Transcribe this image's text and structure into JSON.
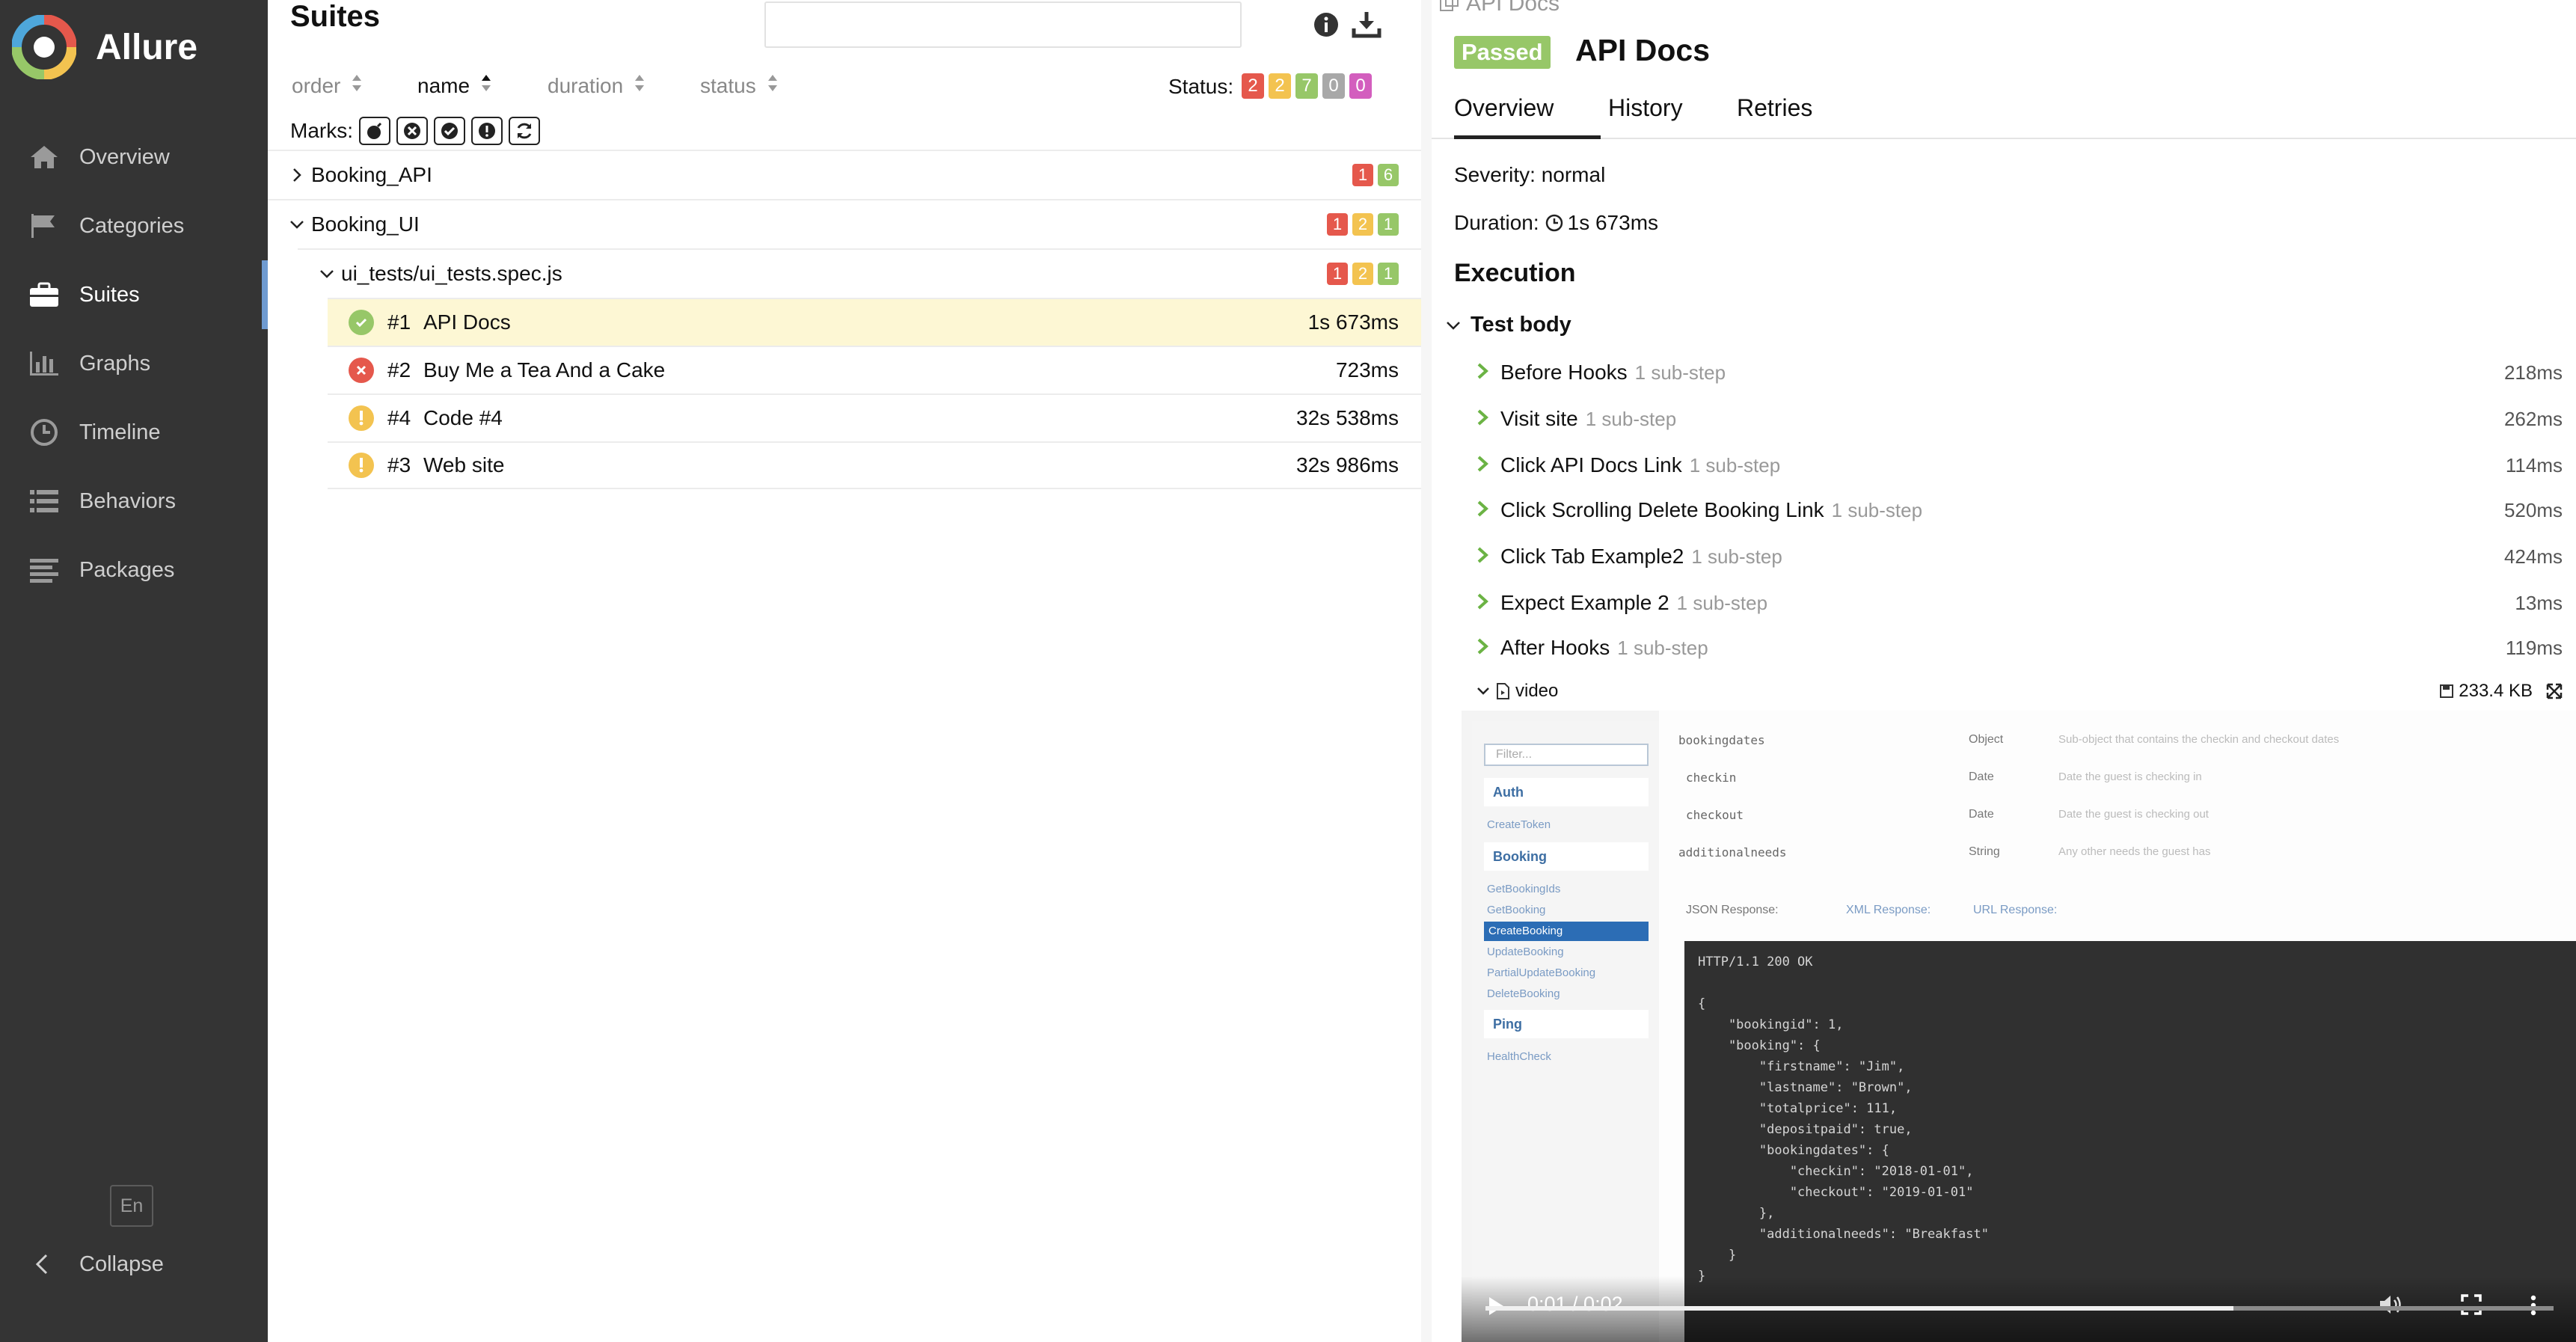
{
  "sidebar": {
    "brand": "Allure",
    "items": [
      {
        "label": "Overview",
        "icon": "home-icon"
      },
      {
        "label": "Categories",
        "icon": "flag-icon"
      },
      {
        "label": "Suites",
        "icon": "briefcase-icon"
      },
      {
        "label": "Graphs",
        "icon": "bar-chart-icon"
      },
      {
        "label": "Timeline",
        "icon": "clock-icon"
      },
      {
        "label": "Behaviors",
        "icon": "list-icon"
      },
      {
        "label": "Packages",
        "icon": "align-left-icon"
      }
    ],
    "active_item": "Suites",
    "language": "En",
    "collapse": "Collapse",
    "accent": "#6f9bd1"
  },
  "suites": {
    "title": "Suites",
    "search": {
      "value": "",
      "placeholder": ""
    },
    "sort": {
      "order": "order",
      "name": "name",
      "duration": "duration",
      "status": "status"
    },
    "status_label": "Status:",
    "status_counts": [
      {
        "value": "2",
        "color": "#e5584c"
      },
      {
        "value": "2",
        "color": "#f3c350"
      },
      {
        "value": "7",
        "color": "#97c768"
      },
      {
        "value": "0",
        "color": "#a8a8a8"
      },
      {
        "value": "0",
        "color": "#d35ebe"
      }
    ],
    "marks_label": "Marks:",
    "groups": [
      {
        "name": "Booking_API",
        "expanded": false,
        "badges": [
          {
            "v": "1",
            "c": "red"
          },
          {
            "v": "6",
            "c": "green"
          }
        ]
      },
      {
        "name": "Booking_UI",
        "expanded": true,
        "badges": [
          {
            "v": "1",
            "c": "red"
          },
          {
            "v": "2",
            "c": "yellow"
          },
          {
            "v": "1",
            "c": "green"
          }
        ]
      },
      {
        "name": "ui_tests/ui_tests.spec.js",
        "expanded": true,
        "badges": [
          {
            "v": "1",
            "c": "red"
          },
          {
            "v": "2",
            "c": "yellow"
          },
          {
            "v": "1",
            "c": "green"
          }
        ]
      }
    ],
    "tests": [
      {
        "num": "#1",
        "name": "API Docs",
        "duration": "1s 673ms",
        "status": "passed"
      },
      {
        "num": "#2",
        "name": "Buy Me a Tea And a Cake",
        "duration": "723ms",
        "status": "failed"
      },
      {
        "num": "#4",
        "name": "Code #4",
        "duration": "32s 538ms",
        "status": "broken"
      },
      {
        "num": "#3",
        "name": "Web site",
        "duration": "32s 986ms",
        "status": "broken"
      }
    ]
  },
  "detail": {
    "breadcrumb": "API Docs",
    "status_badge": "Passed",
    "title": "API Docs",
    "tabs": [
      "Overview",
      "History",
      "Retries"
    ],
    "severity": "Severity: normal",
    "duration_label": "Duration:",
    "duration_value": "1s 673ms",
    "execution": "Execution",
    "test_body": "Test body",
    "steps": [
      {
        "name": "Before Hooks",
        "sub": "1 sub-step",
        "duration": "218ms"
      },
      {
        "name": "Visit site",
        "sub": "1 sub-step",
        "duration": "262ms"
      },
      {
        "name": "Click API Docs Link",
        "sub": "1 sub-step",
        "duration": "114ms"
      },
      {
        "name": "Click Scrolling Delete Booking Link",
        "sub": "1 sub-step",
        "duration": "520ms"
      },
      {
        "name": "Click Tab Example2",
        "sub": "1 sub-step",
        "duration": "424ms"
      },
      {
        "name": "Expect Example 2",
        "sub": "1 sub-step",
        "duration": "13ms"
      },
      {
        "name": "After Hooks",
        "sub": "1 sub-step",
        "duration": "119ms"
      }
    ],
    "attachment": {
      "name": "video",
      "size": "233.4 KB"
    },
    "video": {
      "time": "0:01 / 0:02",
      "progress": 0.7,
      "filter_placeholder": "Filter...",
      "sections": [
        "Auth",
        "Booking",
        "Ping"
      ],
      "auth_links": [
        "CreateToken"
      ],
      "booking_links": [
        "GetBookingIds",
        "GetBooking",
        "CreateBooking",
        "UpdateBooking",
        "PartialUpdateBooking",
        "DeleteBooking"
      ],
      "ping_links": [
        "HealthCheck"
      ],
      "table": [
        {
          "field": "bookingdates",
          "type": "Object",
          "desc": "Sub-object that contains the checkin and checkout dates"
        },
        {
          "field": "checkin",
          "type": "Date",
          "desc": "Date the guest is checking in"
        },
        {
          "field": "checkout",
          "type": "Date",
          "desc": "Date the guest is checking out"
        },
        {
          "field": "additionalneeds",
          "type": "String",
          "desc": "Any other needs the guest has"
        }
      ],
      "response_tabs": [
        "JSON Response:",
        "XML Response:",
        "URL Response:"
      ],
      "code": "HTTP/1.1 200 OK\n\n{\n    \"bookingid\": 1,\n    \"booking\": {\n        \"firstname\": \"Jim\",\n        \"lastname\": \"Brown\",\n        \"totalprice\": 111,\n        \"depositpaid\": true,\n        \"bookingdates\": {\n            \"checkin\": \"2018-01-01\",\n            \"checkout\": \"2019-01-01\"\n        },\n        \"additionalneeds\": \"Breakfast\"\n    }\n}"
    }
  }
}
